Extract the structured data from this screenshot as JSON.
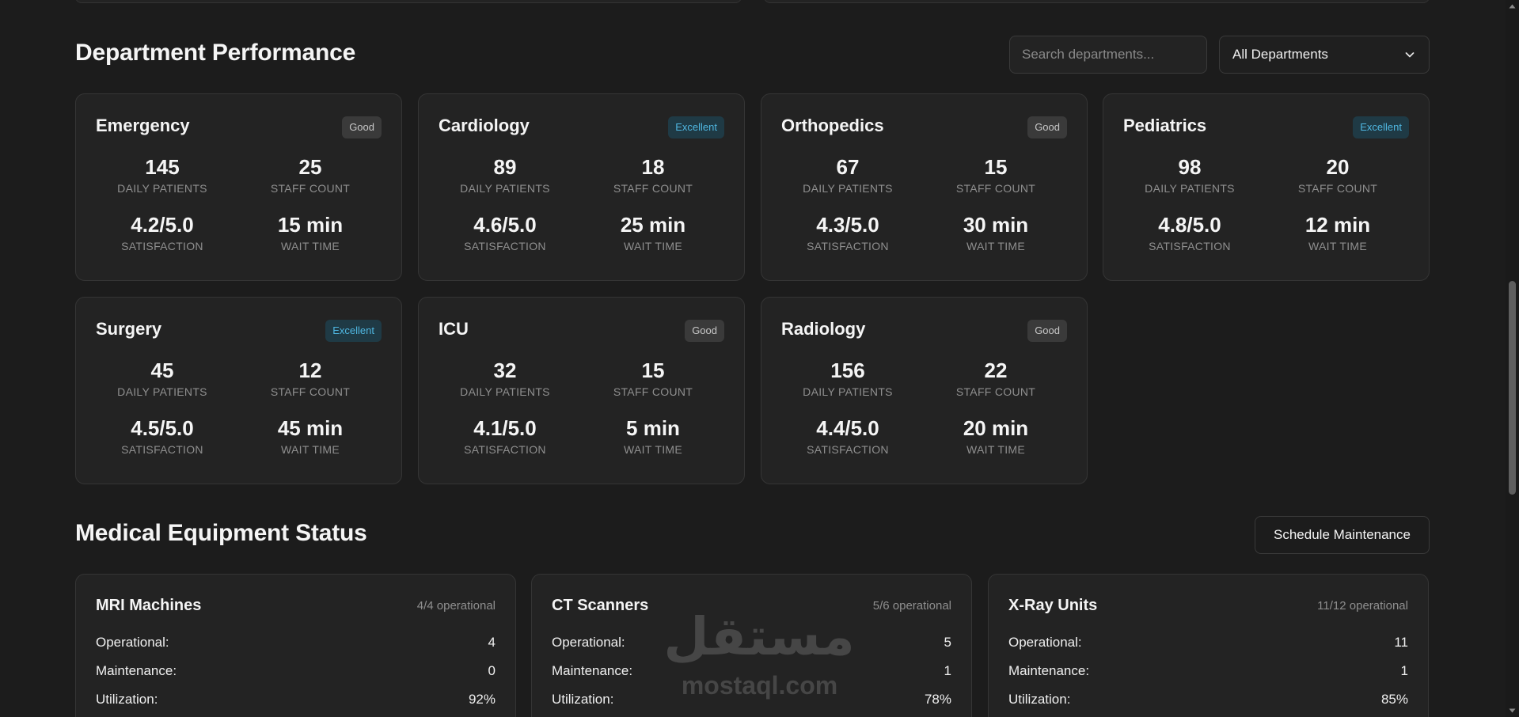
{
  "department_section": {
    "title": "Department Performance",
    "search_placeholder": "Search departments...",
    "filter_selected": "All Departments",
    "metric_labels": {
      "daily_patients": "DAILY PATIENTS",
      "staff_count": "STAFF COUNT",
      "satisfaction": "SATISFACTION",
      "wait_time": "WAIT TIME"
    },
    "departments": [
      {
        "name": "Emergency",
        "badge": "Good",
        "daily_patients": "145",
        "staff_count": "25",
        "satisfaction": "4.2/5.0",
        "wait_time": "15 min"
      },
      {
        "name": "Cardiology",
        "badge": "Excellent",
        "daily_patients": "89",
        "staff_count": "18",
        "satisfaction": "4.6/5.0",
        "wait_time": "25 min"
      },
      {
        "name": "Orthopedics",
        "badge": "Good",
        "daily_patients": "67",
        "staff_count": "15",
        "satisfaction": "4.3/5.0",
        "wait_time": "30 min"
      },
      {
        "name": "Pediatrics",
        "badge": "Excellent",
        "daily_patients": "98",
        "staff_count": "20",
        "satisfaction": "4.8/5.0",
        "wait_time": "12 min"
      },
      {
        "name": "Surgery",
        "badge": "Excellent",
        "daily_patients": "45",
        "staff_count": "12",
        "satisfaction": "4.5/5.0",
        "wait_time": "45 min"
      },
      {
        "name": "ICU",
        "badge": "Good",
        "daily_patients": "32",
        "staff_count": "15",
        "satisfaction": "4.1/5.0",
        "wait_time": "5 min"
      },
      {
        "name": "Radiology",
        "badge": "Good",
        "daily_patients": "156",
        "staff_count": "22",
        "satisfaction": "4.4/5.0",
        "wait_time": "20 min"
      }
    ]
  },
  "equipment_section": {
    "title": "Medical Equipment Status",
    "schedule_button": "Schedule Maintenance",
    "row_labels": {
      "operational": "Operational:",
      "maintenance": "Maintenance:",
      "utilization": "Utilization:"
    },
    "items": [
      {
        "name": "MRI Machines",
        "status": "4/4 operational",
        "operational": "4",
        "maintenance": "0",
        "utilization": "92%"
      },
      {
        "name": "CT Scanners",
        "status": "5/6 operational",
        "operational": "5",
        "maintenance": "1",
        "utilization": "78%"
      },
      {
        "name": "X-Ray Units",
        "status": "11/12 operational",
        "operational": "11",
        "maintenance": "1",
        "utilization": "85%"
      }
    ]
  },
  "watermark": {
    "arabic": "مستقل",
    "latin": "mostaql.com"
  },
  "colors": {
    "background": "#1c1c1c",
    "card": "#232323",
    "border": "#353535",
    "excellent_badge_text": "#4fb6e0",
    "excellent_badge_bg": "#1f3a45",
    "good_badge_bg": "#3a3a3a"
  },
  "icons": {
    "filter_dropdown": "chevron-down-icon"
  }
}
